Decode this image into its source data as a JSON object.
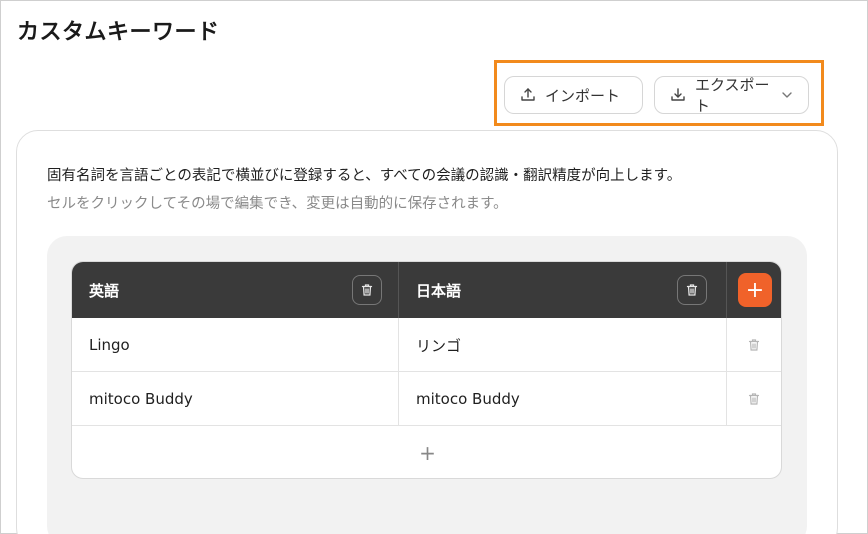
{
  "page": {
    "title": "カスタムキーワード"
  },
  "toolbar": {
    "import_label": "インポート",
    "export_label": "エクスポート",
    "import_icon": "upload-icon",
    "export_icon": "download-icon",
    "highlight_color": "#f28a1c"
  },
  "description": {
    "line1": "固有名詞を言語ごとの表記で横並びに登録すると、すべての会議の認識・翻訳精度が向上します。",
    "line2": "セルをクリックしてその場で編集でき、変更は自動的に保存されます。"
  },
  "table": {
    "columns": [
      {
        "label": "英語"
      },
      {
        "label": "日本語"
      }
    ],
    "add_column_label": "+",
    "add_row_label": "+",
    "rows": [
      {
        "en": "Lingo",
        "ja": "リンゴ"
      },
      {
        "en": "mitoco Buddy",
        "ja": "mitoco Buddy"
      }
    ],
    "accent_color": "#f0622a",
    "header_color": "#3a3a3a"
  }
}
